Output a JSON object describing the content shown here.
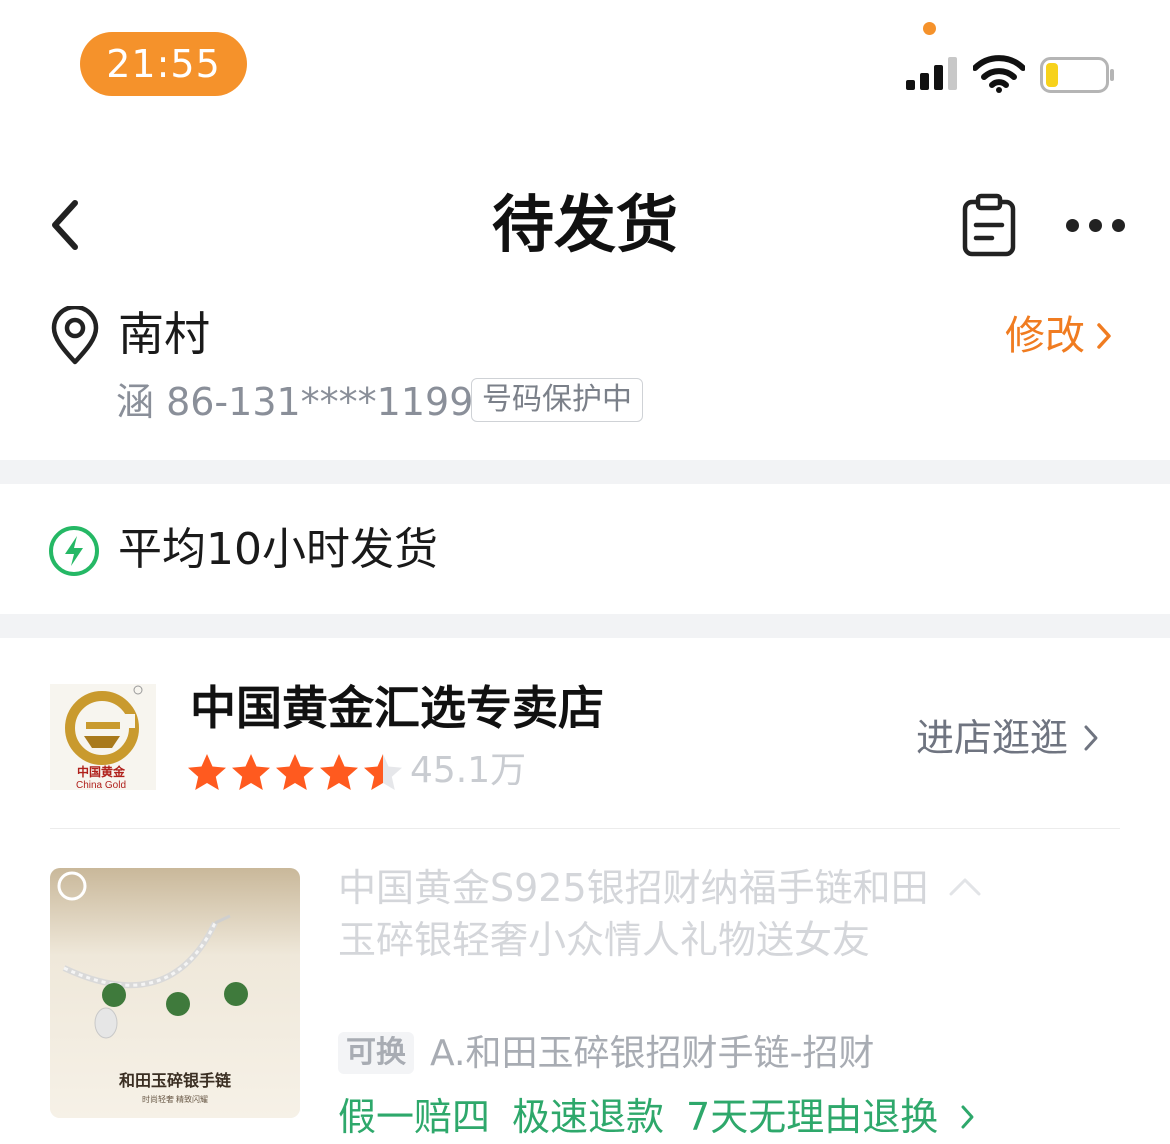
{
  "status_bar": {
    "time": "21:55"
  },
  "nav": {
    "title": "待发货"
  },
  "address": {
    "name": "南村",
    "edit_label": "修改",
    "contact": "涵 86-131****1199",
    "protect_badge": "号码保护中"
  },
  "shipping": {
    "text": "平均10小时发货"
  },
  "store": {
    "name": "中国黄金汇选专卖店",
    "rating": 4.5,
    "rating_max": 5,
    "sales": "45.1万",
    "enter_label": "进店逛逛",
    "logo_text_cn": "中国黄金",
    "logo_text_en": "China Gold"
  },
  "product": {
    "title": "中国黄金S925银招财纳福手链和田玉碎银轻奢小众情人礼物送女友",
    "sku_tag": "可换",
    "sku": "A.和田玉碎银招财手链-招财",
    "services": [
      "假一赔四",
      "极速退款",
      "7天无理由退换"
    ],
    "image_caption": "和田玉碎银手链",
    "image_subcaption": "时尚轻奢 精致闪耀"
  },
  "colors": {
    "accent_orange": "#F5922B",
    "edit_orange": "#F07C21",
    "service_green": "#2ea86b",
    "bolt_green": "#25B865",
    "star_orange": "#FF5A1F"
  }
}
